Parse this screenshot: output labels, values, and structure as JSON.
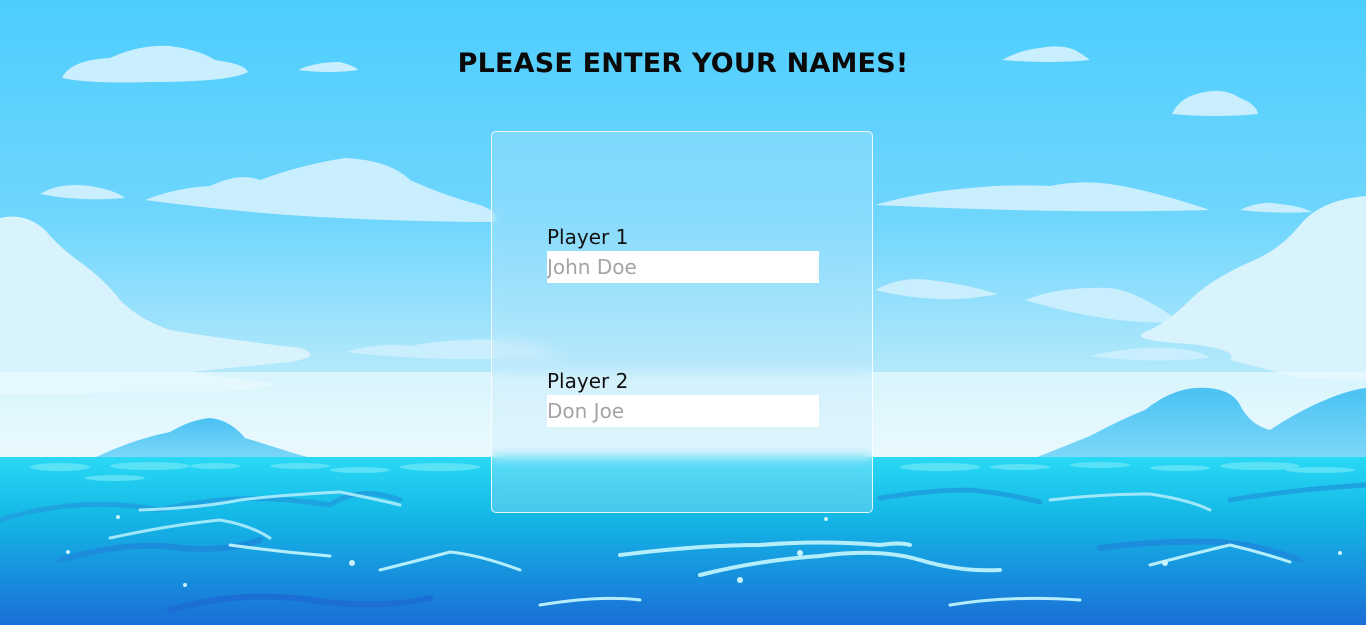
{
  "title": "PLEASE ENTER YOUR NAMES!",
  "players": [
    {
      "label": "Player 1",
      "value": "",
      "placeholder": "John Doe"
    },
    {
      "label": "Player 2",
      "value": "",
      "placeholder": "Don Joe"
    }
  ],
  "colors": {
    "sky_top": "#4dcdfd",
    "sky_bottom": "#e9f9fd",
    "sea_surface": "#25d3f2",
    "sea_deep": "#1a75d8",
    "title_text": "#0a0a0a",
    "input_bg": "#ffffff",
    "placeholder": "#a3a3a8"
  },
  "background": "sky-clouds-mountains-ocean-waves"
}
